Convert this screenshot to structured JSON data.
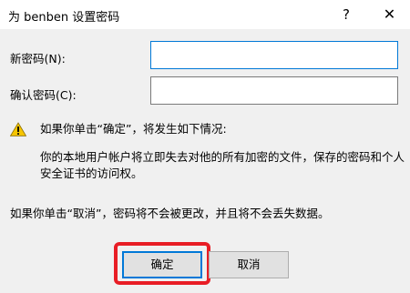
{
  "window": {
    "title": "为 benben 设置密码",
    "help_glyph": "?",
    "close_glyph": "✕"
  },
  "fields": {
    "new_password_label": "新密码(N):",
    "new_password_value": "",
    "confirm_password_label": "确认密码(C):",
    "confirm_password_value": ""
  },
  "warning": {
    "icon": "warning-icon",
    "heading": "如果你单击“确定”，将发生如下情况:",
    "body_line1": "你的本地用户帐户将立即失去对他的所有加密的文件，保存的密码和个人",
    "body_line2": "安全证书的访问权。",
    "cancel_note": "如果你单击“取消”，密码将不会被更改，并且将不会丢失数据。"
  },
  "buttons": {
    "ok_label": "确定",
    "cancel_label": "取消"
  },
  "colors": {
    "highlight": "#e81d25",
    "accent": "#0078d7",
    "warning_fill": "#f7c600"
  }
}
